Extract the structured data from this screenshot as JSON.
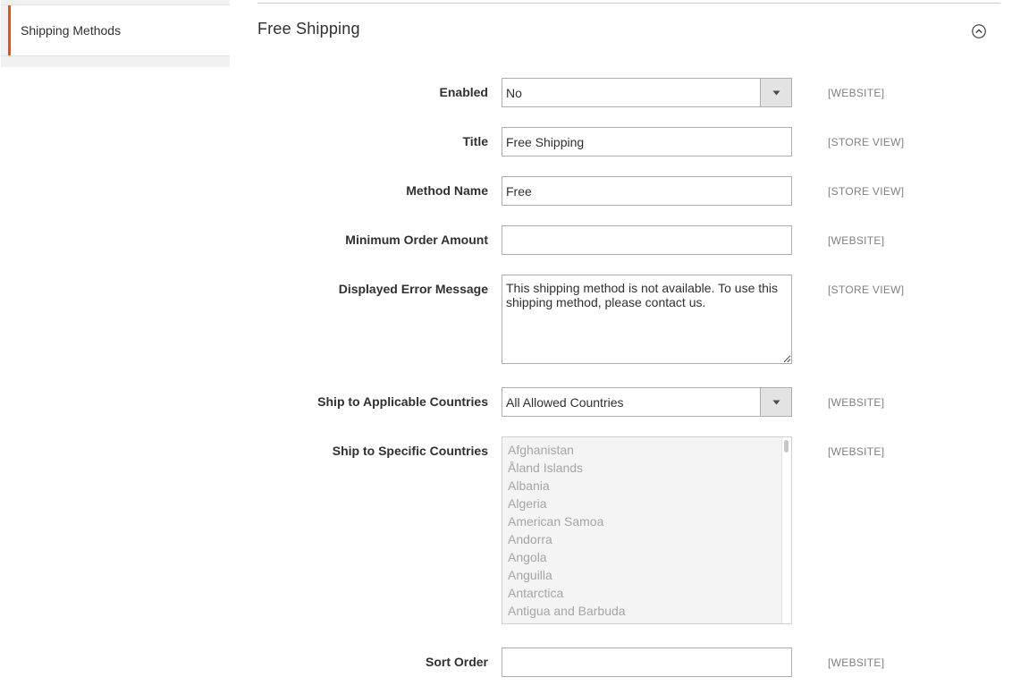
{
  "sidebar": {
    "items": [
      {
        "label": "Shipping Methods"
      }
    ]
  },
  "section": {
    "title": "Free Shipping",
    "collapse_icon": "chevron-up-circle-icon"
  },
  "fields": {
    "enabled": {
      "label": "Enabled",
      "value": "No",
      "scope": "[WEBSITE]"
    },
    "title": {
      "label": "Title",
      "value": "Free Shipping",
      "scope": "[STORE VIEW]"
    },
    "method_name": {
      "label": "Method Name",
      "value": "Free",
      "scope": "[STORE VIEW]"
    },
    "min_order_amount": {
      "label": "Minimum Order Amount",
      "value": "",
      "scope": "[WEBSITE]"
    },
    "error_message": {
      "label": "Displayed Error Message",
      "value": "This shipping method is not available. To use this shipping method, please contact us.",
      "scope": "[STORE VIEW]"
    },
    "applicable_countries": {
      "label": "Ship to Applicable Countries",
      "value": "All Allowed Countries",
      "scope": "[WEBSITE]"
    },
    "specific_countries": {
      "label": "Ship to Specific Countries",
      "scope": "[WEBSITE]",
      "options": [
        "Afghanistan",
        "Åland Islands",
        "Albania",
        "Algeria",
        "American Samoa",
        "Andorra",
        "Angola",
        "Anguilla",
        "Antarctica",
        "Antigua and Barbuda"
      ]
    },
    "sort_order": {
      "label": "Sort Order",
      "value": "",
      "scope": "[WEBSITE]"
    }
  },
  "colors": {
    "accent": "#eb5202",
    "label": "#303030",
    "scope": "#808080",
    "disabled_text": "#a5a5a5"
  }
}
